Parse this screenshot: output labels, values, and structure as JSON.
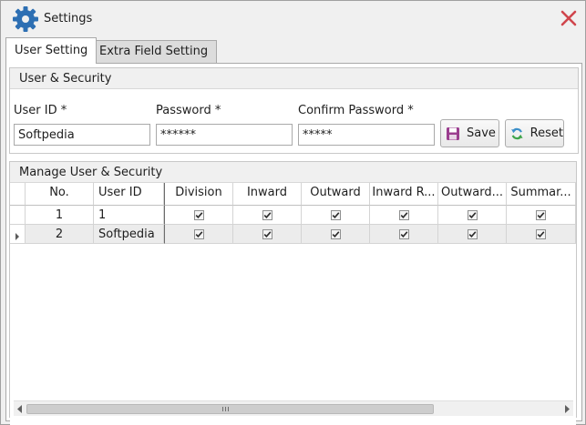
{
  "window": {
    "title": "Settings",
    "icons": {
      "app": "gear-icon",
      "close": "close-icon"
    },
    "colors": {
      "app_icon": "#2d6fb3",
      "close_icon": "#d0454c"
    }
  },
  "tabs": [
    {
      "label": "User Setting",
      "active": true
    },
    {
      "label": "Extra Field Setting",
      "active": false
    }
  ],
  "user_security": {
    "header": "User & Security",
    "user_id": {
      "label": "User ID *",
      "value": "Softpedia"
    },
    "password": {
      "label": "Password *",
      "value": "******"
    },
    "confirm_password": {
      "label": "Confirm Password *",
      "value": "*****"
    },
    "save_label": "Save",
    "reset_label": "Reset"
  },
  "manage": {
    "header": "Manage User & Security",
    "columns": [
      "No.",
      "User ID",
      "Division",
      "Inward",
      "Outward",
      "Inward R...",
      "Outward...",
      "Summar..."
    ],
    "rows": [
      {
        "no": "1",
        "user_id": "1",
        "checks": [
          true,
          true,
          true,
          true,
          true,
          true
        ],
        "current": false
      },
      {
        "no": "2",
        "user_id": "Softpedia",
        "checks": [
          true,
          true,
          true,
          true,
          true,
          true
        ],
        "current": true
      }
    ]
  }
}
